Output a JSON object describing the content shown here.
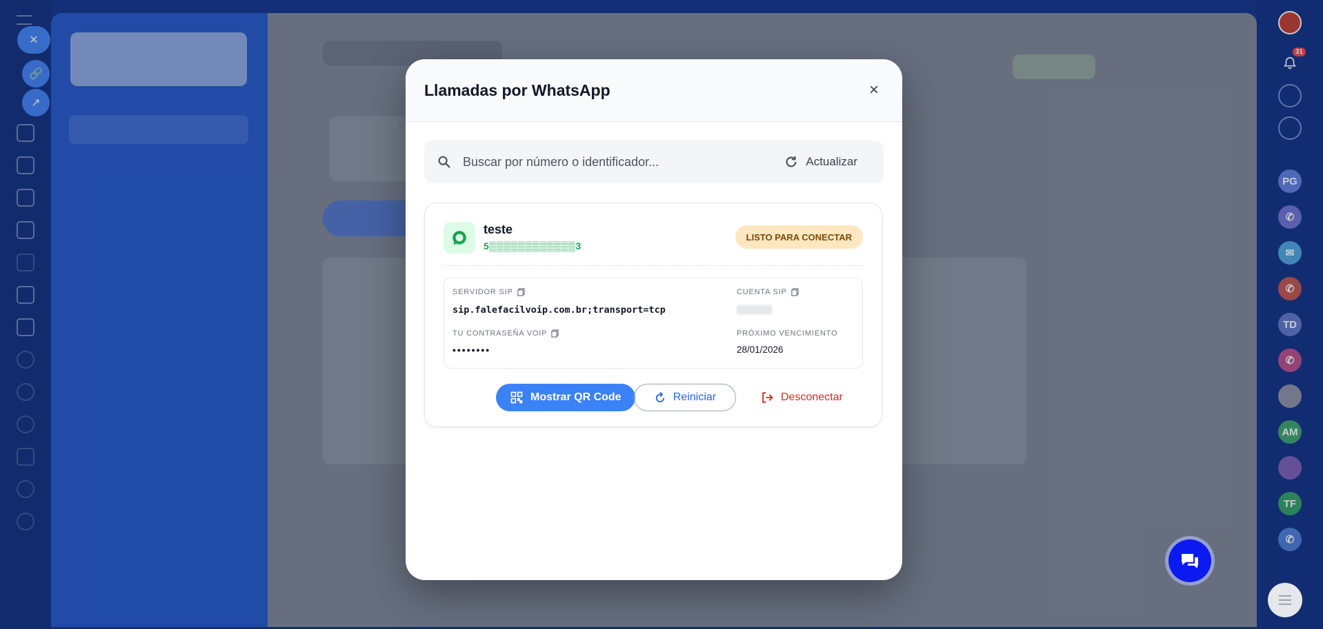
{
  "modal": {
    "title": "Llamadas por WhatsApp",
    "close_label": "×"
  },
  "search": {
    "placeholder": "Buscar por número o identificador...",
    "refresh_label": "Actualizar"
  },
  "account": {
    "name": "teste",
    "number": "5▒▒▒▒▒▒▒▒▒▒▒▒3",
    "status": "LISTO PARA CONECTAR",
    "fields": {
      "sip_server_label": "SERVIDOR SIP",
      "sip_server_value": "sip.falefacilvoip.com.br;transport=tcp",
      "sip_account_label": "CUENTA SIP",
      "sip_account_value": "▒▒▒▒▒▒",
      "voip_password_label": "TU CONTRASEÑA VOIP",
      "voip_password_value": "••••••••",
      "next_expiry_label": "PRÓXIMO VENCIMIENTO",
      "next_expiry_value": "28/01/2026"
    },
    "actions": {
      "qr_label": "Mostrar QR Code",
      "restart_label": "Reiniciar",
      "disconnect_label": "Desconectar"
    }
  },
  "right_rail": {
    "notifications_count": "31",
    "avatars": [
      "PG",
      "TD",
      "AM",
      "TF"
    ]
  },
  "colors": {
    "primary": "#3b82f6",
    "danger": "#dc2626",
    "success": "#16a34a",
    "badge_bg": "#fde7c0"
  }
}
